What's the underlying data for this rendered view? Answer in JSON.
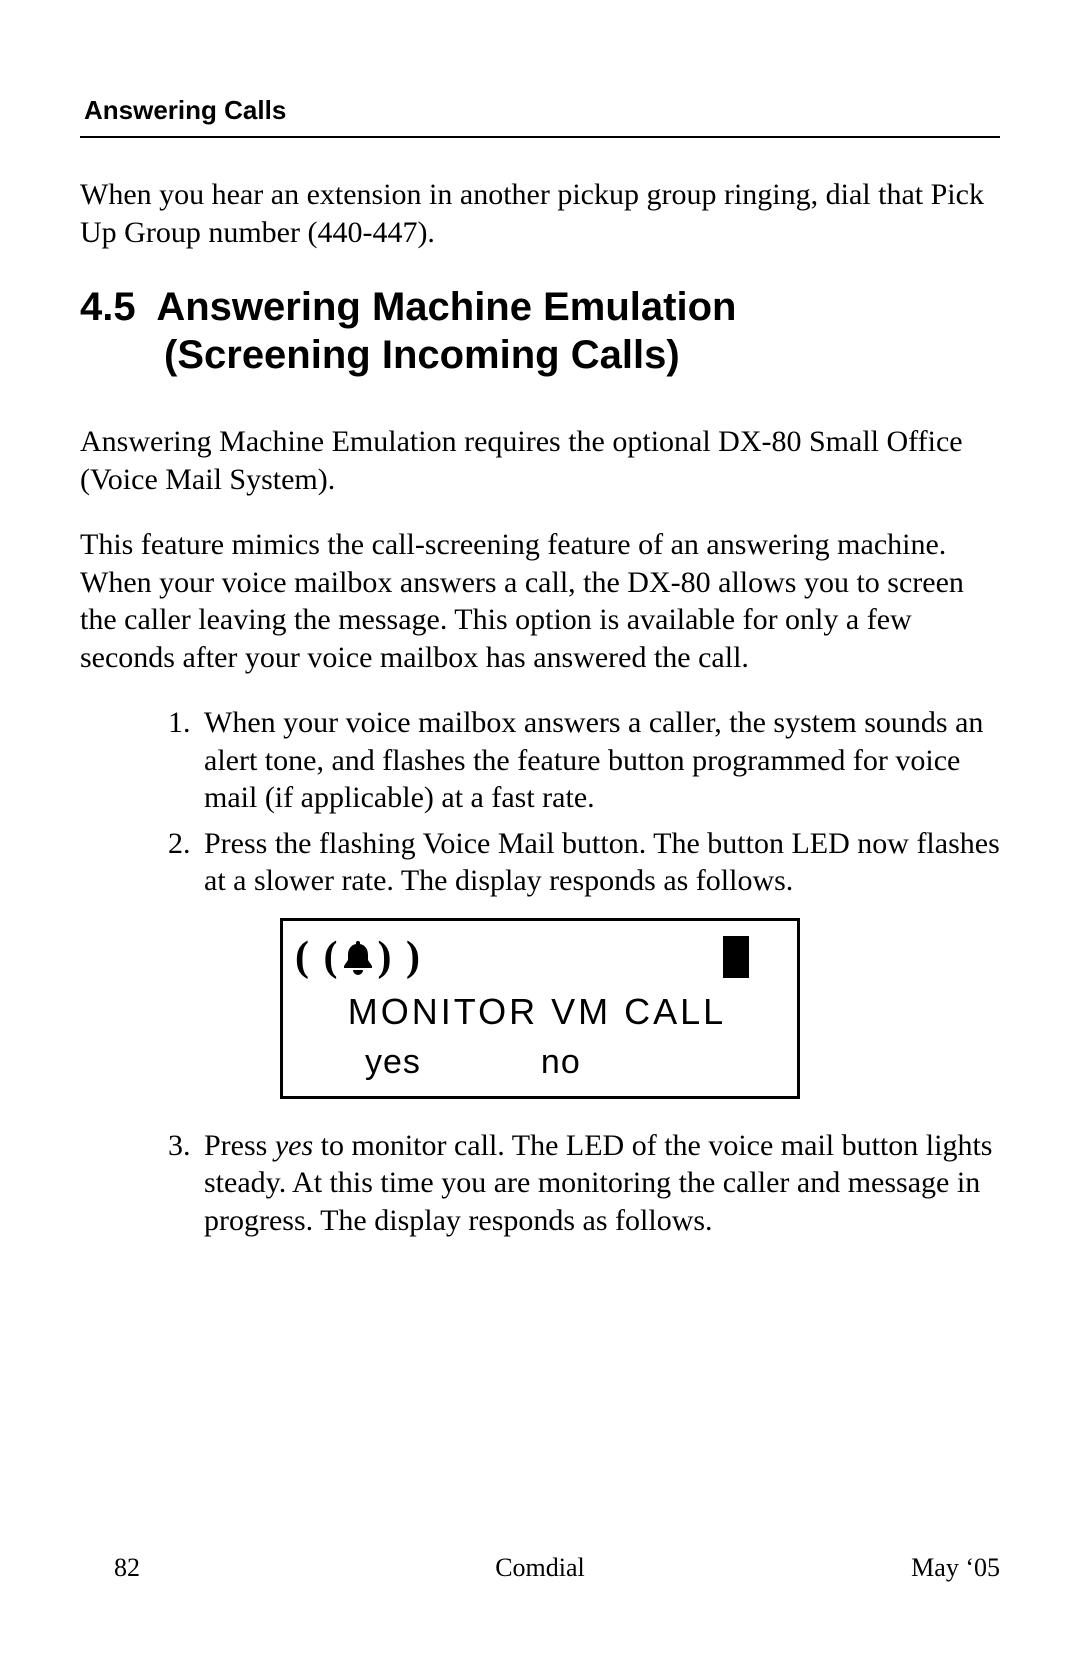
{
  "header": {
    "running_title": "Answering Calls"
  },
  "intro": {
    "paragraph": "When you hear an extension in another pickup group ringing, dial that Pick Up Group number (440-447)."
  },
  "section": {
    "number": "4.5",
    "title_line1": "Answering Machine Emulation",
    "title_line2": "(Screening Incoming Calls)"
  },
  "paragraphs": {
    "p1": "Answering Machine Emulation requires the optional DX-80 Small Office (Voice Mail System).",
    "p2": "This feature mimics the call-screening feature of an answering machine. When your voice mailbox answers a call, the DX-80 allows you to screen the caller leaving the message.  This option is available for only a few seconds after your voice mailbox has answered the call."
  },
  "steps": {
    "s1": "When your voice mailbox answers a caller, the system sounds an alert tone, and flashes the feature button programmed for voice mail (if applicable) at a fast rate.",
    "s2": "Press the flashing Voice Mail button.  The button LED now flashes at a slower rate.  The display responds as follows.",
    "s3_prefix": "Press ",
    "s3_yes": "yes",
    "s3_rest": " to monitor call.  The LED of the voice mail button lights steady.  At this time you are monitoring the caller and message in progress.  The display responds as follows."
  },
  "display": {
    "ring_left": "( (",
    "ring_right": ") )",
    "title": "MONITOR VM CALL",
    "option_yes": "yes",
    "option_no": "no"
  },
  "footer": {
    "page_number": "82",
    "center": "Comdial",
    "date": "May ‘05"
  }
}
